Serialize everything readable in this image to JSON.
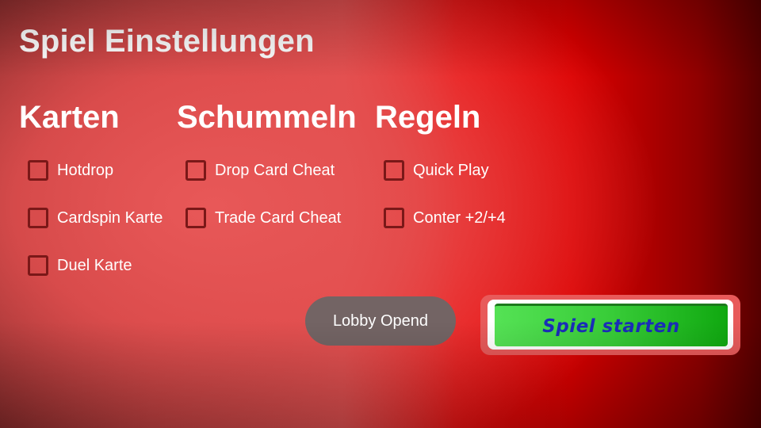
{
  "title": "Spiel Einstellungen",
  "columns": [
    {
      "heading": "Karten",
      "options": [
        {
          "label": "Hotdrop",
          "checked": false
        },
        {
          "label": "Cardspin Karte",
          "checked": false
        },
        {
          "label": "Duel Karte",
          "checked": false
        }
      ]
    },
    {
      "heading": "Schummeln",
      "options": [
        {
          "label": "Drop Card Cheat",
          "checked": false
        },
        {
          "label": "Trade Card Cheat",
          "checked": false
        }
      ]
    },
    {
      "heading": "Regeln",
      "options": [
        {
          "label": "Quick Play",
          "checked": false
        },
        {
          "label": "Conter +2/+4",
          "checked": false
        }
      ]
    }
  ],
  "buttons": {
    "lobby_label": "Lobby Opend",
    "start_label": "Spiel starten"
  },
  "colors": {
    "checkbox_border": "#7a1818",
    "lobby_button": "#736464",
    "start_button": "#38cc38",
    "start_text": "#1a2db8"
  }
}
